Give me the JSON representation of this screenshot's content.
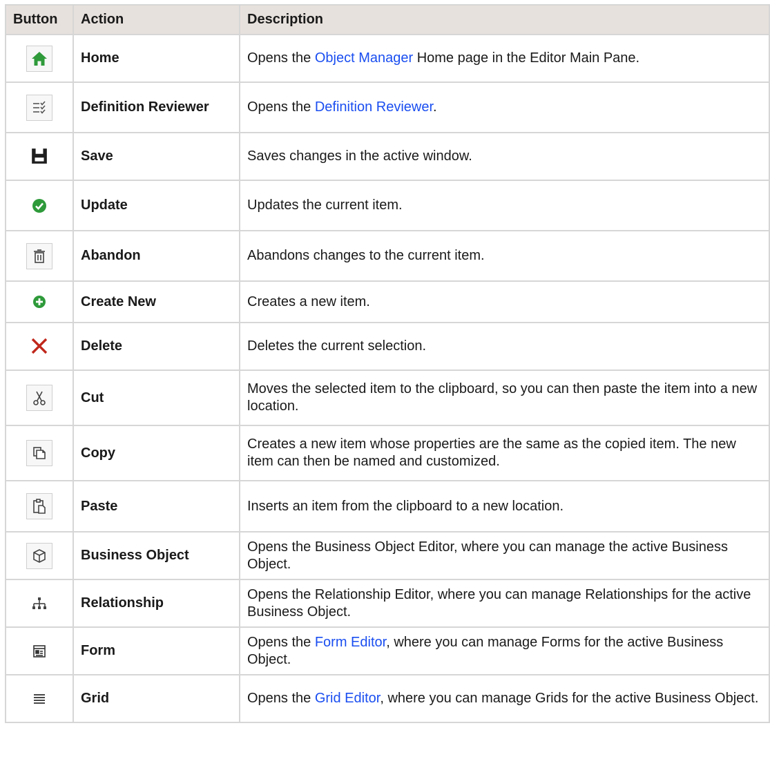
{
  "table": {
    "headers": {
      "button": "Button",
      "action": "Action",
      "description": "Description"
    },
    "rows": [
      {
        "icon": "home-icon",
        "action": "Home",
        "desc_before": "Opens the ",
        "link": "Object Manager",
        "desc_after": " Home page in the Editor Main Pane."
      },
      {
        "icon": "definition-reviewer-icon",
        "action": "Definition Reviewer",
        "desc_before": "Opens the ",
        "link": "Definition Reviewer",
        "desc_after": "."
      },
      {
        "icon": "save-icon",
        "action": "Save",
        "desc": "Saves changes in the active window."
      },
      {
        "icon": "update-check-icon",
        "action": "Update",
        "desc": "Updates the current item."
      },
      {
        "icon": "trash-icon",
        "action": "Abandon",
        "desc": "Abandons changes to the current item."
      },
      {
        "icon": "plus-circle-icon",
        "action": "Create New",
        "desc": "Creates a new item."
      },
      {
        "icon": "delete-x-icon",
        "action": "Delete",
        "desc": "Deletes the current selection."
      },
      {
        "icon": "scissors-icon",
        "action": "Cut",
        "desc": "Moves the selected item to the clipboard, so you can then paste the item into a new location."
      },
      {
        "icon": "copy-icon",
        "action": "Copy",
        "desc": "Creates a new item whose properties are the same as the copied item. The new item can then be named and customized."
      },
      {
        "icon": "paste-icon",
        "action": "Paste",
        "desc": "Inserts an item from the clipboard to a new location."
      },
      {
        "icon": "cube-icon",
        "action": "Business Object",
        "desc": "Opens the Business Object Editor, where you can manage the active Business Object."
      },
      {
        "icon": "relationship-hierarchy-icon",
        "action": "Relationship",
        "desc": "Opens the Relationship Editor, where you can manage Relationships for the active Business Object."
      },
      {
        "icon": "form-icon",
        "action": "Form",
        "desc_before": "Opens the ",
        "link": "Form Editor",
        "desc_after": ", where you can manage Forms for the active Business Object."
      },
      {
        "icon": "grid-lines-icon",
        "action": "Grid",
        "desc_before": "Opens the ",
        "link": "Grid Editor",
        "desc_after": ", where you can manage Grids for the active Business Object."
      }
    ]
  },
  "colors": {
    "header_bg": "#e7e1dd",
    "border": "#d6d6d6",
    "link": "#1a4ef0",
    "green": "#2e9a3a",
    "red": "#c0271b"
  }
}
